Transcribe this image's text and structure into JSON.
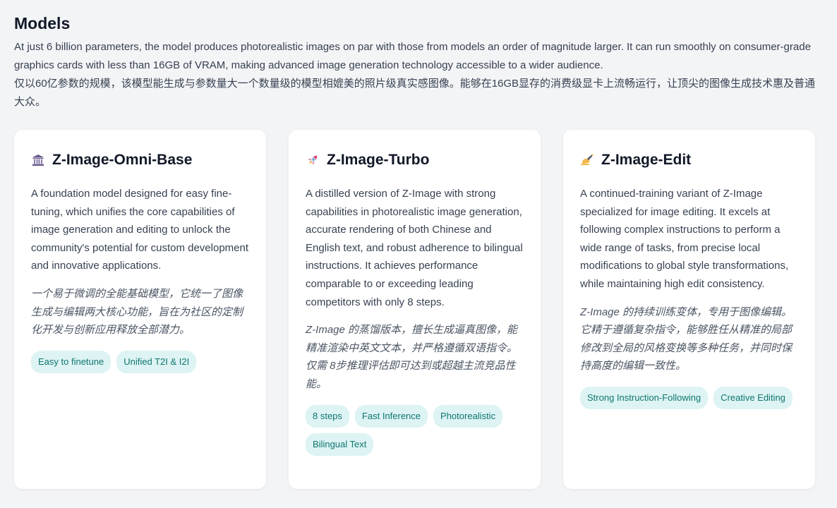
{
  "page": {
    "title": "Models",
    "intro_en": "At just 6 billion parameters, the model produces photorealistic images on par with those from models an order of magnitude larger. It can run smoothly on consumer-grade graphics cards with less than 16GB of VRAM, making advanced image generation technology accessible to a wider audience.",
    "intro_zh": "仅以60亿参数的规模，该模型能生成与参数量大一个数量级的模型相媲美的照片级真实感图像。能够在16GB显存的消费级显卡上流畅运行，让顶尖的图像生成技术惠及普通大众。"
  },
  "cards": [
    {
      "icon": "bank-building-icon",
      "title": "Z-Image-Omni-Base",
      "desc_en": "A foundation model designed for easy fine-tuning, which unifies the core capabilities of image generation and editing to unlock the community's potential for custom development and innovative applications.",
      "desc_zh": "一个易于微调的全能基础模型，它统一了图像生成与编辑两大核心功能，旨在为社区的定制化开发与创新应用释放全部潜力。",
      "tags": [
        "Easy to finetune",
        "Unified T2I & I2I"
      ]
    },
    {
      "icon": "rocket-icon",
      "title": "Z-Image-Turbo",
      "desc_en": "A distilled version of Z-Image with strong capabilities in photorealistic image generation, accurate rendering of both Chinese and English text, and robust adherence to bilingual instructions. It achieves performance comparable to or exceeding leading competitors with only 8 steps.",
      "desc_zh": "Z-Image 的蒸馏版本，擅长生成逼真图像，能精准渲染中英文文本，并严格遵循双语指令。仅需 8步推理评估即可达到或超越主流竞品性能。",
      "tags": [
        "8 steps",
        "Fast Inference",
        "Photorealistic",
        "Bilingual Text"
      ]
    },
    {
      "icon": "writing-hand-icon",
      "title": "Z-Image-Edit",
      "desc_en": "A continued-training variant of Z-Image specialized for image editing. It excels at following complex instructions to perform a wide range of tasks, from precise local modifications to global style transformations, while maintaining high edit consistency.",
      "desc_zh": "Z-Image 的持续训练变体，专用于图像编辑。它精于遵循复杂指令，能够胜任从精准的局部修改到全局的风格变换等多种任务，并同时保持高度的编辑一致性。",
      "tags": [
        "Strong Instruction-Following",
        "Creative Editing"
      ]
    }
  ]
}
